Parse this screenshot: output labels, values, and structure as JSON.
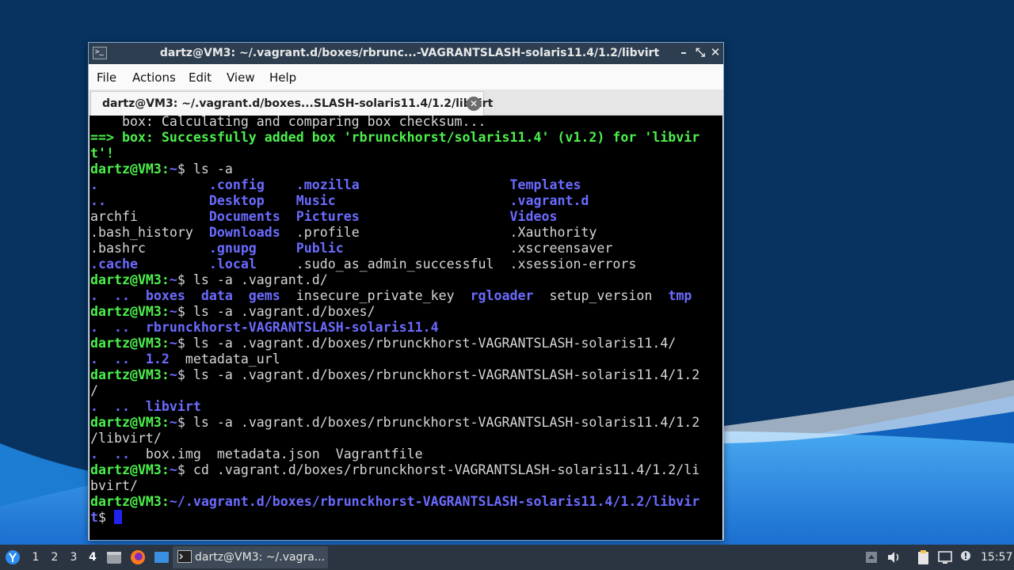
{
  "window": {
    "title": "dartz@VM3: ~/.vagrant.d/boxes/rbrunc...-VAGRANTSLASH-solaris11.4/1.2/libvirt",
    "minimize": "–",
    "maximize": "⤡",
    "close": "✕"
  },
  "menu": [
    "File",
    "Actions",
    "Edit",
    "View",
    "Help"
  ],
  "tab": {
    "label": "dartz@VM3: ~/.vagrant.d/boxes...SLASH-solaris11.4/1.2/libvirt",
    "close": "✕"
  },
  "terminal": {
    "lines": [
      [
        {
          "t": "    box: Calculating and comparing box checksum...",
          "c": "w"
        }
      ],
      [
        {
          "t": "==> box: Successfully added box 'rbrunckhorst/solaris11.4' (v1.2) for 'libvir",
          "c": "g"
        }
      ],
      [
        {
          "t": "t'!",
          "c": "g"
        }
      ],
      [
        {
          "t": "dartz@VM3:",
          "c": "g"
        },
        {
          "t": "~",
          "c": "b"
        },
        {
          "t": "$ ls -a",
          "c": "w"
        }
      ],
      [
        {
          "t": ".",
          "c": "b"
        },
        {
          "t": "              ",
          "c": "w"
        },
        {
          "t": ".config",
          "c": "b"
        },
        {
          "t": "    ",
          "c": "w"
        },
        {
          "t": ".mozilla",
          "c": "b"
        },
        {
          "t": "                   ",
          "c": "w"
        },
        {
          "t": "Templates",
          "c": "b"
        }
      ],
      [
        {
          "t": "..",
          "c": "b"
        },
        {
          "t": "             ",
          "c": "w"
        },
        {
          "t": "Desktop",
          "c": "b"
        },
        {
          "t": "    ",
          "c": "w"
        },
        {
          "t": "Music",
          "c": "b"
        },
        {
          "t": "                      ",
          "c": "w"
        },
        {
          "t": ".vagrant.d",
          "c": "b"
        }
      ],
      [
        {
          "t": "archfi",
          "c": "w"
        },
        {
          "t": "         ",
          "c": "w"
        },
        {
          "t": "Documents",
          "c": "b"
        },
        {
          "t": "  ",
          "c": "w"
        },
        {
          "t": "Pictures",
          "c": "b"
        },
        {
          "t": "                   ",
          "c": "w"
        },
        {
          "t": "Videos",
          "c": "b"
        }
      ],
      [
        {
          "t": ".bash_history  ",
          "c": "w"
        },
        {
          "t": "Downloads",
          "c": "b"
        },
        {
          "t": "  .profile                   .Xauthority",
          "c": "w"
        }
      ],
      [
        {
          "t": ".bashrc        ",
          "c": "w"
        },
        {
          "t": ".gnupg",
          "c": "b"
        },
        {
          "t": "     ",
          "c": "w"
        },
        {
          "t": "Public",
          "c": "b"
        },
        {
          "t": "                     .xscreensaver",
          "c": "w"
        }
      ],
      [
        {
          "t": ".cache",
          "c": "b"
        },
        {
          "t": "         ",
          "c": "w"
        },
        {
          "t": ".local",
          "c": "b"
        },
        {
          "t": "     .sudo_as_admin_successful  .xsession-errors",
          "c": "w"
        }
      ],
      [
        {
          "t": "dartz@VM3:",
          "c": "g"
        },
        {
          "t": "~",
          "c": "b"
        },
        {
          "t": "$ ls -a .vagrant.d/",
          "c": "w"
        }
      ],
      [
        {
          "t": ".  ..  boxes  data  gems",
          "c": "b"
        },
        {
          "t": "  insecure_private_key  ",
          "c": "w"
        },
        {
          "t": "rgloader",
          "c": "b"
        },
        {
          "t": "  setup_version  ",
          "c": "w"
        },
        {
          "t": "tmp",
          "c": "b"
        }
      ],
      [
        {
          "t": "dartz@VM3:",
          "c": "g"
        },
        {
          "t": "~",
          "c": "b"
        },
        {
          "t": "$ ls -a .vagrant.d/boxes/",
          "c": "w"
        }
      ],
      [
        {
          "t": ".  ..  rbrunckhorst-VAGRANTSLASH-solaris11.4",
          "c": "b"
        }
      ],
      [
        {
          "t": "dartz@VM3:",
          "c": "g"
        },
        {
          "t": "~",
          "c": "b"
        },
        {
          "t": "$ ls -a .vagrant.d/boxes/rbrunckhorst-VAGRANTSLASH-solaris11.4/",
          "c": "w"
        }
      ],
      [
        {
          "t": ".  ..  1.2",
          "c": "b"
        },
        {
          "t": "  metadata_url",
          "c": "w"
        }
      ],
      [
        {
          "t": "dartz@VM3:",
          "c": "g"
        },
        {
          "t": "~",
          "c": "b"
        },
        {
          "t": "$ ls -a .vagrant.d/boxes/rbrunckhorst-VAGRANTSLASH-solaris11.4/1.2",
          "c": "w"
        }
      ],
      [
        {
          "t": "/",
          "c": "w"
        }
      ],
      [
        {
          "t": ".  ..  libvirt",
          "c": "b"
        }
      ],
      [
        {
          "t": "dartz@VM3:",
          "c": "g"
        },
        {
          "t": "~",
          "c": "b"
        },
        {
          "t": "$ ls -a .vagrant.d/boxes/rbrunckhorst-VAGRANTSLASH-solaris11.4/1.2",
          "c": "w"
        }
      ],
      [
        {
          "t": "/libvirt/",
          "c": "w"
        }
      ],
      [
        {
          "t": ".  ..",
          "c": "b"
        },
        {
          "t": "  box.img  metadata.json  Vagrantfile",
          "c": "w"
        }
      ],
      [
        {
          "t": "dartz@VM3:",
          "c": "g"
        },
        {
          "t": "~",
          "c": "b"
        },
        {
          "t": "$ cd .vagrant.d/boxes/rbrunckhorst-VAGRANTSLASH-solaris11.4/1.2/li",
          "c": "w"
        }
      ],
      [
        {
          "t": "bvirt/",
          "c": "w"
        }
      ],
      [
        {
          "t": "dartz@VM3:",
          "c": "g"
        },
        {
          "t": "~/.vagrant.d/boxes/rbrunckhorst-VAGRANTSLASH-solaris11.4/1.2/libvir",
          "c": "b"
        }
      ],
      [
        {
          "t": "t",
          "c": "b"
        },
        {
          "t": "$ ",
          "c": "w"
        }
      ]
    ]
  },
  "taskbar": {
    "workspaces": [
      "1",
      "2",
      "3",
      "4"
    ],
    "active_workspace": "4",
    "task_label": "dartz@VM3: ~/.vagra...",
    "clock": "15:57"
  },
  "colors": {
    "terminal_bg": "#000000",
    "prompt_green": "#4cf04c",
    "dir_blue": "#6b6bff",
    "titlebar": "#2c3e50",
    "taskbar": "#2b3541"
  }
}
